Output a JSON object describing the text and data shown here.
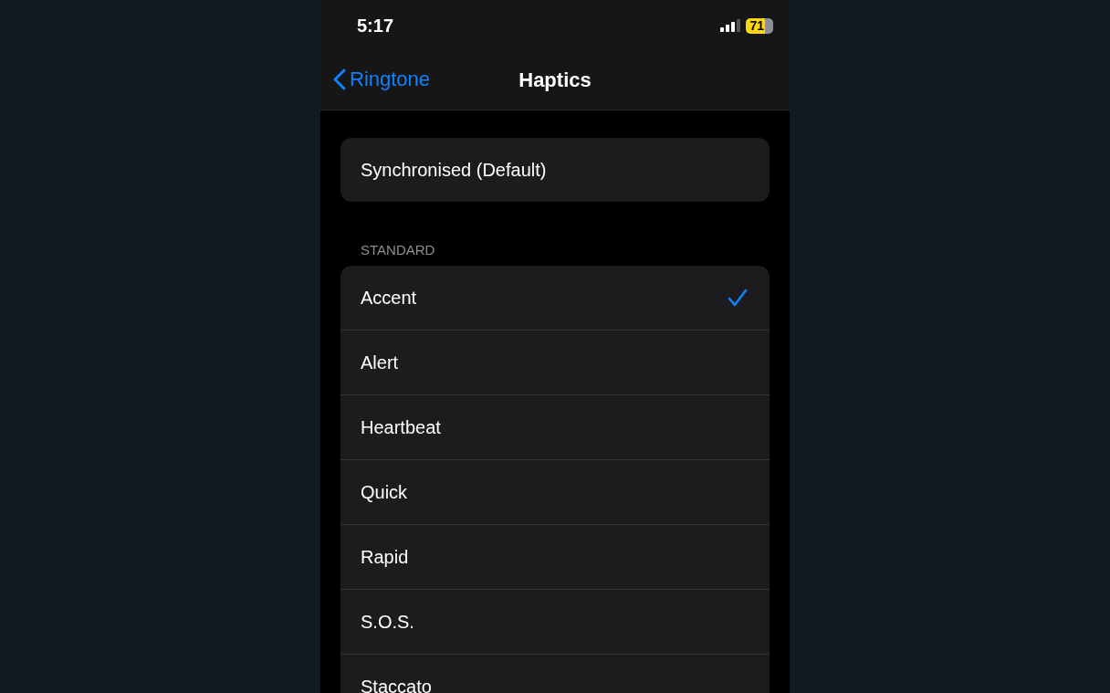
{
  "status_bar": {
    "time": "5:17",
    "battery": "71"
  },
  "nav": {
    "back": "Ringtone",
    "title": "Haptics"
  },
  "default_option": {
    "label": "Synchronised (Default)",
    "selected": false
  },
  "section": {
    "header": "STANDARD",
    "items": [
      {
        "label": "Accent",
        "selected": true
      },
      {
        "label": "Alert",
        "selected": false
      },
      {
        "label": "Heartbeat",
        "selected": false
      },
      {
        "label": "Quick",
        "selected": false
      },
      {
        "label": "Rapid",
        "selected": false
      },
      {
        "label": "S.O.S.",
        "selected": false
      },
      {
        "label": "Staccato",
        "selected": false
      }
    ]
  }
}
